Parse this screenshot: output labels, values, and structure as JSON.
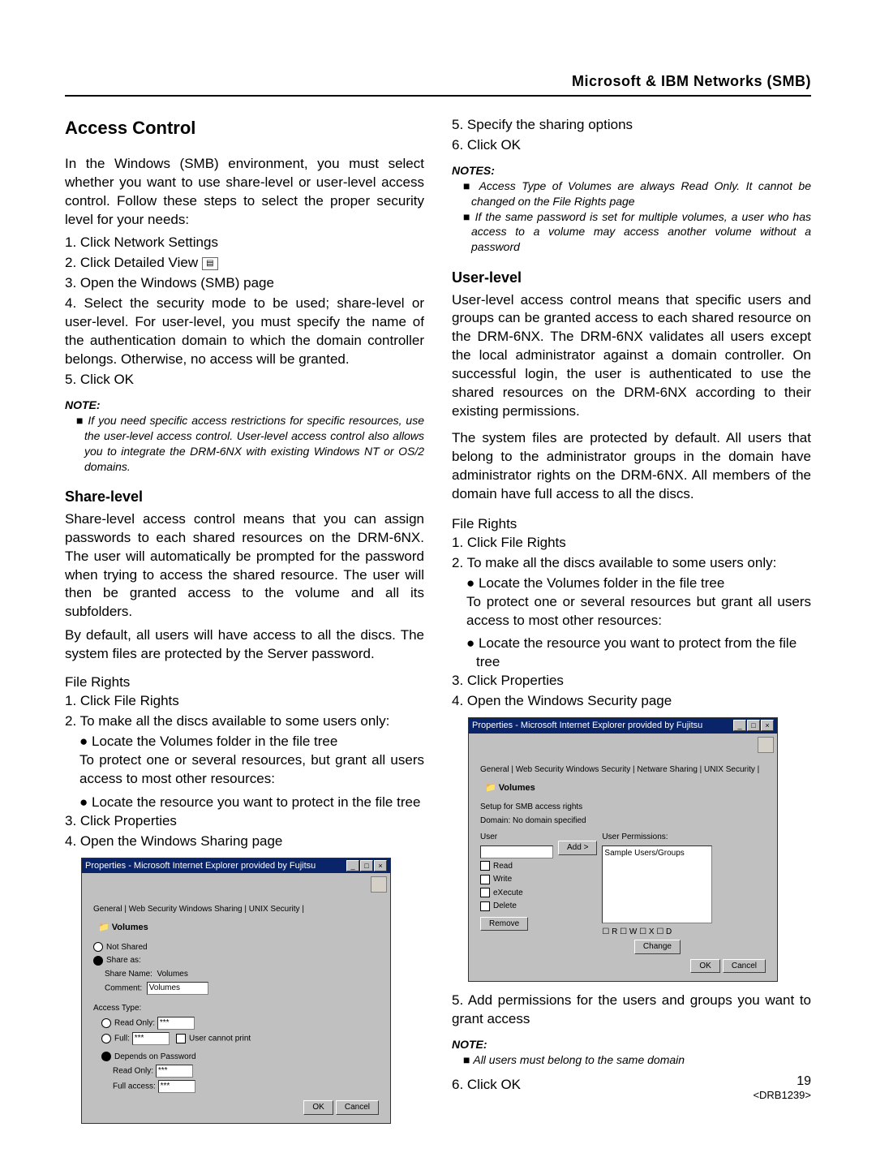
{
  "header": "Microsoft & IBM Networks (SMB)",
  "title": "Access Control",
  "intro": "In the Windows (SMB) environment, you must select whether you want to use share-level or user-level access control.  Follow these steps to select the proper security level for your needs:",
  "steps_main": {
    "s1": "1. Click Network Settings",
    "s2": "2. Click Detailed View",
    "s3": "3. Open the Windows (SMB) page",
    "s4": "4. Select the security mode to be used; share-level or user-level. For user-level, you must specify the name of the authentication domain to which the domain controller belongs. Otherwise, no access will be granted.",
    "s5": "5. Click OK"
  },
  "note1_head": "NOTE:",
  "note1": "If you need specific access restrictions for specific resources, use the user-level access control. User-level access control also allows you to integrate the DRM-6NX with existing Windows NT or OS/2 domains.",
  "share_head": "Share-level",
  "share_p1": "Share-level access control means that you can assign passwords to each shared resources on the DRM-6NX. The user will automatically be prompted for the password when trying to access the shared resource. The user will then be granted access to the volume and all its subfolders.",
  "share_p2": "By default, all users will have access to all the discs. The system files are protected by the Server password.",
  "share_fr_head": "File Rights",
  "share_fr": {
    "s1": "1. Click File Rights",
    "s2": "2. To make all the discs available to some users only:",
    "b1": "● Locate the Volumes folder in the file tree",
    "b1a": "To protect one or several resources, but grant all users access to most other resources:",
    "b2": "● Locate the resource you want to protect in the file tree",
    "s3": "3. Click Properties",
    "s4": "4. Open the Windows Sharing page"
  },
  "right_top": {
    "s5": "5. Specify the sharing options",
    "s6": "6. Click OK"
  },
  "notes2_head": "NOTES:",
  "notes2a": "Access Type of Volumes are always Read Only. It cannot be changed on the File Rights page",
  "notes2b": "If the same password is set for multiple volumes, a user who has access to a volume may access another volume without a password",
  "user_head": "User-level",
  "user_p1": "User-level access control means that specific users and groups can be granted access to each shared resource on the DRM-6NX.  The DRM-6NX validates all users except the local administrator against a domain controller. On successful login, the user is authenticated to use the shared resources on the DRM-6NX according to their existing permissions.",
  "user_p2": "The system files are protected by default. All users that belong to the administrator groups in the domain have administrator rights on the DRM-6NX.  All members of the domain have full access to all the discs.",
  "user_fr_head": "File Rights",
  "user_fr": {
    "s1": "1. Click File Rights",
    "s2": "2. To make all the discs available to some users only:",
    "b1": "● Locate the Volumes folder in the file tree",
    "b1a": "To protect one or several resources but grant all users access to most other resources:",
    "b2": "● Locate the resource you want to protect from the file tree",
    "s3": "3. Click Properties",
    "s4": "4. Open the Windows Security page"
  },
  "user_after": {
    "s5": "5. Add permissions for the users and groups you want to grant access"
  },
  "note3_head": "NOTE:",
  "note3": "All users must belong to the same domain",
  "user_s6": "6. Click OK",
  "dialog1": {
    "title": "Properties - Microsoft Internet Explorer provided by Fujitsu",
    "tabs": "General | Web Security   Windows Sharing  | UNIX Security |",
    "volumes": "Volumes",
    "not_shared": "Not Shared",
    "share_as": "Share as:",
    "share_name_lbl": "Share Name:",
    "share_name_val": "Volumes",
    "comment_lbl": "Comment:",
    "comment_val": "Volumes",
    "access_type": "Access Type:",
    "read_only": "Read Only:",
    "full": "Full:",
    "user_cannot": "User cannot print",
    "depends": "Depends on Password",
    "ro_lbl": "Read Only:",
    "fa_lbl": "Full access:",
    "ok": "OK",
    "cancel": "Cancel"
  },
  "dialog2": {
    "title": "Properties - Microsoft Internet Explorer provided by Fujitsu",
    "tabs": "General | Web Security   Windows Security  | Netware Sharing | UNIX Security |",
    "volumes": "Volumes",
    "setup": "Setup for SMB access rights",
    "domain": "Domain: No domain specified",
    "user_lbl": "User",
    "perm_lbl": "User Permissions:",
    "add": "Add >",
    "sample": "Sample Users/Groups",
    "read": "Read",
    "write": "Write",
    "execute": "eXecute",
    "delete": "Delete",
    "remove": "Remove",
    "rwxd": "☐ R ☐ W ☐ X ☐ D",
    "change": "Change",
    "ok": "OK",
    "cancel": "Cancel"
  },
  "pagenum": "19",
  "docref": "<DRB1239>"
}
